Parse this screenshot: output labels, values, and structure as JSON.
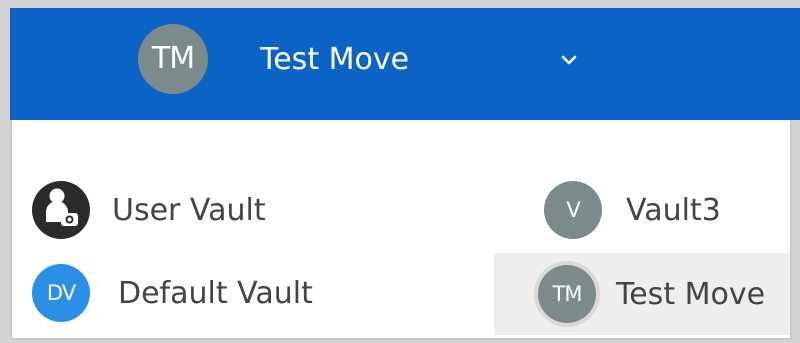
{
  "header": {
    "avatar_initials": "TM",
    "selected_vault": "Test Move",
    "expand_icon": "chevron-down-icon",
    "colors": {
      "background": "#0b63c6",
      "avatar": "#7b8a8b"
    }
  },
  "vaults": [
    {
      "label": "User Vault",
      "icon": "user-lock-icon",
      "color": "#2b2b2b"
    },
    {
      "label": "Default Vault",
      "initials": "DV",
      "color": "#2b8fe8"
    },
    {
      "label": "Vault3",
      "initials": "V",
      "color": "#7b8a8b"
    },
    {
      "label": "Test Move",
      "initials": "TM",
      "color": "#7b8a8b",
      "selected": true
    }
  ]
}
